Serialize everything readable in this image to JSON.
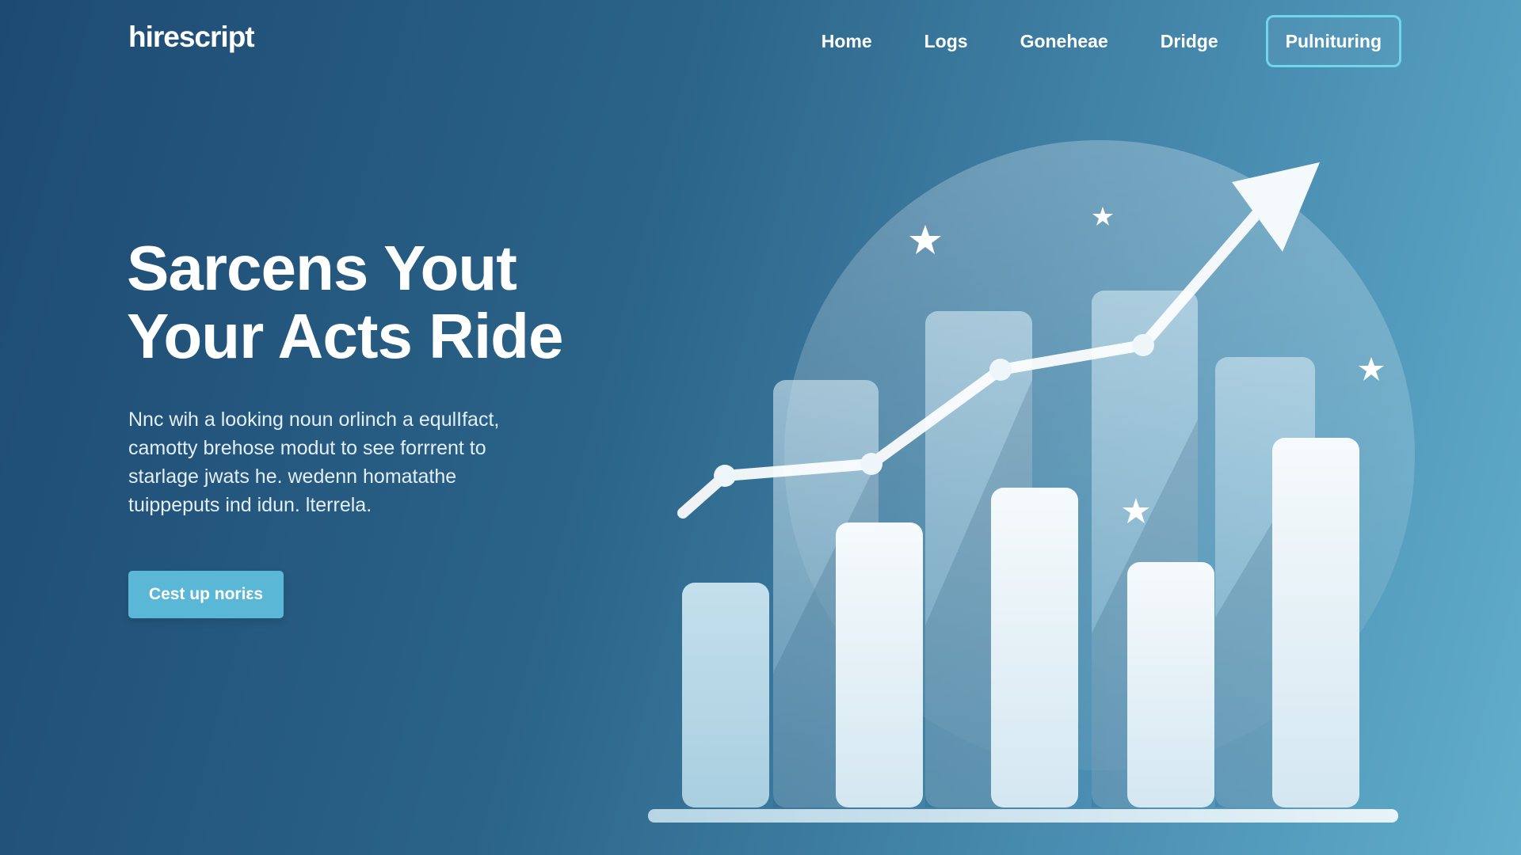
{
  "header": {
    "logo": "hirescript",
    "nav": [
      {
        "label": "Home"
      },
      {
        "label": "Logs"
      },
      {
        "label": "Goneheae"
      },
      {
        "label": "Dridge"
      }
    ],
    "cta_label": "Pulnituring"
  },
  "hero": {
    "title_lines": [
      "Sarcens Yout",
      "Your Acts Ride"
    ],
    "body_lines": [
      "Nnc wih a looking noun orlinch a equlIfact,",
      "camotty brehose modut to see forrrent to",
      "starlage jwats he. wedenn homatathe",
      "tuippeputs ind idun. lterrela."
    ],
    "cta_label": "Cest up noriεs"
  },
  "colors": {
    "background_start": "#1d4a73",
    "background_end": "#62aecb",
    "accent": "#6fd6ec",
    "cta": "#5ab8d6"
  },
  "illustration": {
    "icons": [
      "growth-arrow-icon",
      "star-icon"
    ],
    "back_bar_levels": [
      0.62,
      0.72,
      0.76,
      0.64
    ],
    "front_bar_levels": [
      0.37,
      0.47,
      0.52,
      0.4,
      0.61
    ]
  }
}
